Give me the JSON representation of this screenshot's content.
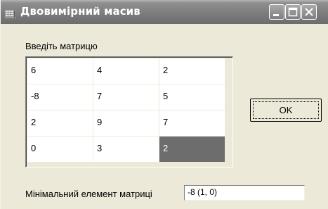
{
  "window": {
    "title": "Двовимірний масив",
    "icon": "app-window-icon",
    "controls": [
      "minimize-icon",
      "maximize-icon",
      "close-icon"
    ]
  },
  "matrix": {
    "label": "Введіть матрицю",
    "rows": [
      [
        "6",
        "4",
        "2"
      ],
      [
        "-8",
        "7",
        "5"
      ],
      [
        "2",
        "9",
        "7"
      ],
      [
        "0",
        "3",
        "2"
      ]
    ],
    "selected_cell": [
      3,
      2
    ]
  },
  "ok_button": {
    "label": "OK"
  },
  "result": {
    "label": "Мінімальний елемент матриці",
    "value": "-8 (1, 0)"
  },
  "colors": {
    "titlebar": "#7b7b7b",
    "window_bg": "#ece9d8",
    "selected_cell": "#6d6d6d"
  }
}
